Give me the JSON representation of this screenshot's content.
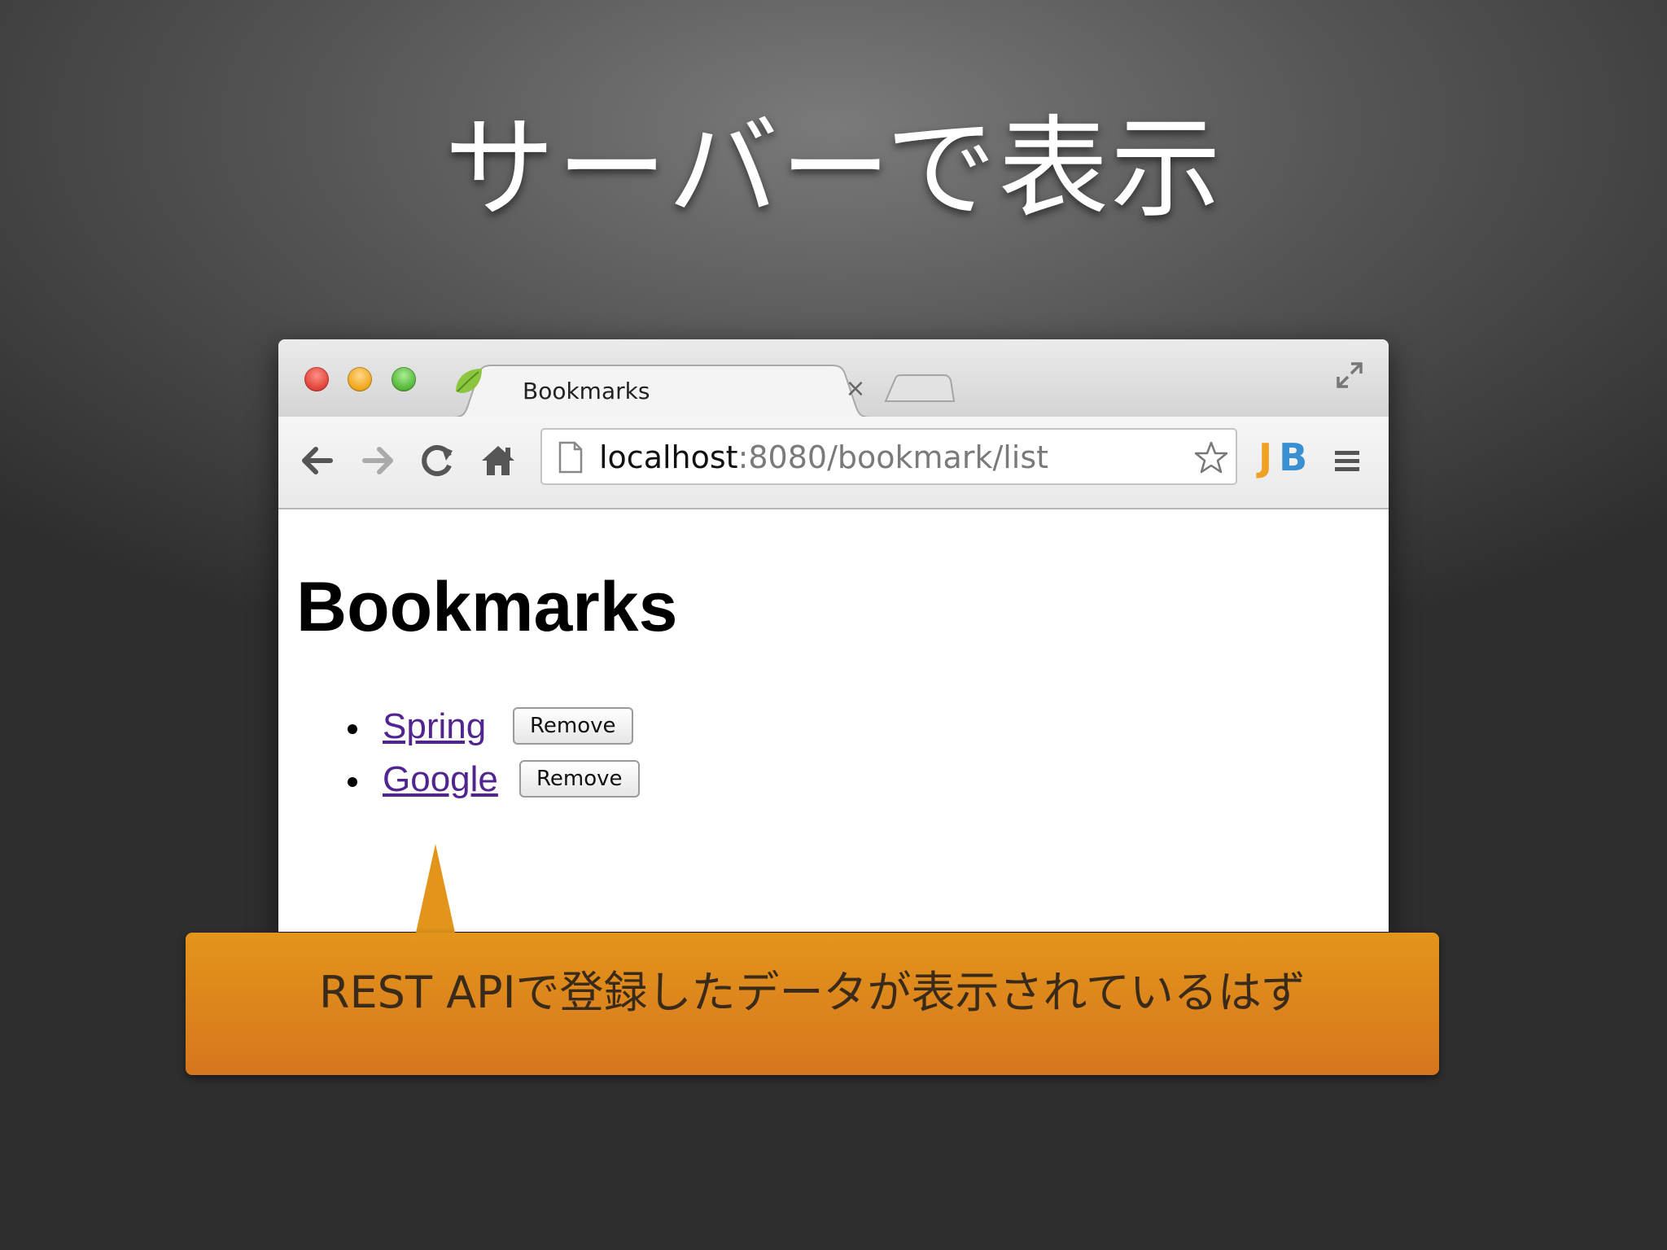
{
  "slide": {
    "title": "サーバーで表示"
  },
  "browser": {
    "tab": {
      "title": "Bookmarks",
      "close_glyph": "×",
      "favicon": "spring-leaf-icon"
    },
    "toolbar": {
      "url_host": "localhost",
      "url_rest": ":8080/bookmark/list",
      "back_icon": "arrow-left-icon",
      "forward_icon": "arrow-right-icon",
      "reload_icon": "reload-icon",
      "home_icon": "home-icon",
      "star_icon": "star-icon",
      "extension_label": "JB",
      "menu_icon": "hamburger-menu-icon"
    },
    "page": {
      "heading": "Bookmarks",
      "bookmarks": [
        {
          "name": "Spring",
          "button_label": "Remove"
        },
        {
          "name": "Google",
          "button_label": "Remove"
        }
      ]
    }
  },
  "callout": {
    "text": "REST APIで登録したデータが表示されているはず"
  },
  "colors": {
    "callout": "#e08a1c",
    "link": "#52248f",
    "extension_j": "#f0a023",
    "extension_b": "#3a8fd0"
  }
}
